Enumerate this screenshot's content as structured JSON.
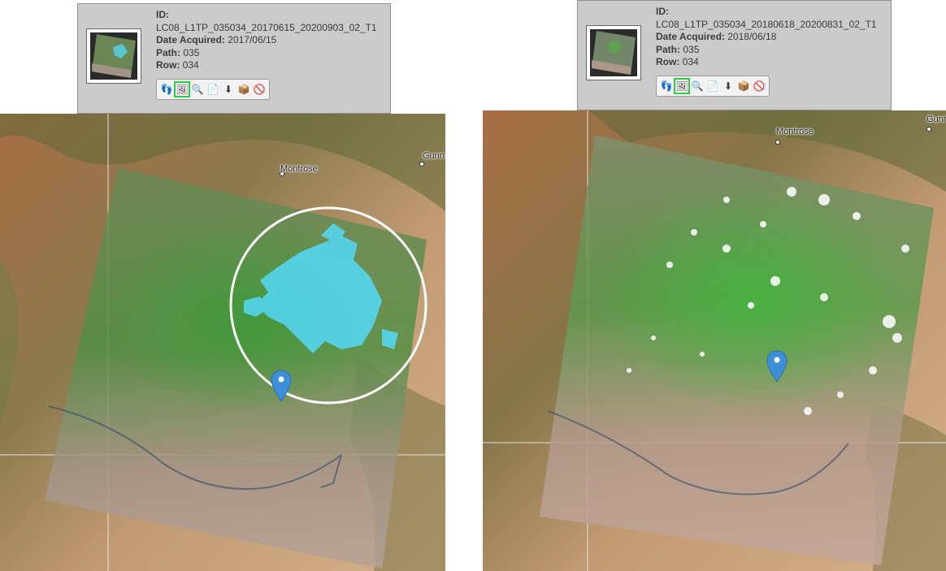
{
  "scenes": [
    {
      "id_label": "ID:",
      "id_value": "LC08_L1TP_035034_20170615_20200903_02_T1",
      "date_label": "Date Acquired:",
      "date_value": "2017/06/15",
      "path_label": "Path:",
      "path_value": "035",
      "row_label": "Row:",
      "row_value": "034",
      "places": [
        "Montrose",
        "Gunn"
      ],
      "highlight_circle": true
    },
    {
      "id_label": "ID:",
      "id_value": "LC08_L1TP_035034_20180618_20200831_02_T1",
      "date_label": "Date Acquired:",
      "date_value": "2018/06/18",
      "path_label": "Path:",
      "path_value": "035",
      "row_label": "Row:",
      "row_value": "034",
      "places": [
        "Montrose",
        "Gunr"
      ],
      "highlight_circle": false
    }
  ],
  "tools": [
    {
      "icon": "footprint-icon",
      "glyph": "👣",
      "active": false
    },
    {
      "icon": "overlay-icon",
      "glyph": "🖼",
      "active": true
    },
    {
      "icon": "metadata-icon",
      "glyph": "🔍",
      "active": false
    },
    {
      "icon": "compare-icon",
      "glyph": "📄",
      "active": false
    },
    {
      "icon": "download-icon",
      "glyph": "⬇",
      "active": false
    },
    {
      "icon": "order-icon",
      "glyph": "📦",
      "active": false
    },
    {
      "icon": "exclude-icon",
      "glyph": "🚫",
      "active": false
    }
  ],
  "colors": {
    "panel_bg": "#cbcbcb",
    "snow": "#55d6ee",
    "vegetation": "#5fb84a",
    "marker": "#3f8fd8"
  }
}
